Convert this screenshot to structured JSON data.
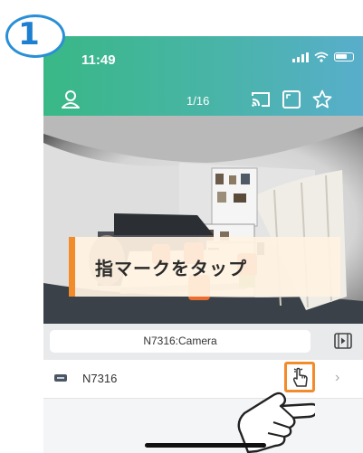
{
  "step_number": "1",
  "status_bar": {
    "time": "11:49"
  },
  "toolbar": {
    "camera_counter": "1/16",
    "icons": [
      "user-icon",
      "cast-icon",
      "fullscreen-icon",
      "star-icon"
    ]
  },
  "overlay": {
    "instruction": "指マークをタップ"
  },
  "camera_bar": {
    "camera_name": "N7316:Camera"
  },
  "device_list": {
    "items": [
      {
        "name": "N7316"
      }
    ]
  },
  "colors": {
    "header_start": "#39b886",
    "header_end": "#58aecb",
    "accent_orange": "#f28b2a",
    "badge_blue": "#2b8fd6"
  }
}
